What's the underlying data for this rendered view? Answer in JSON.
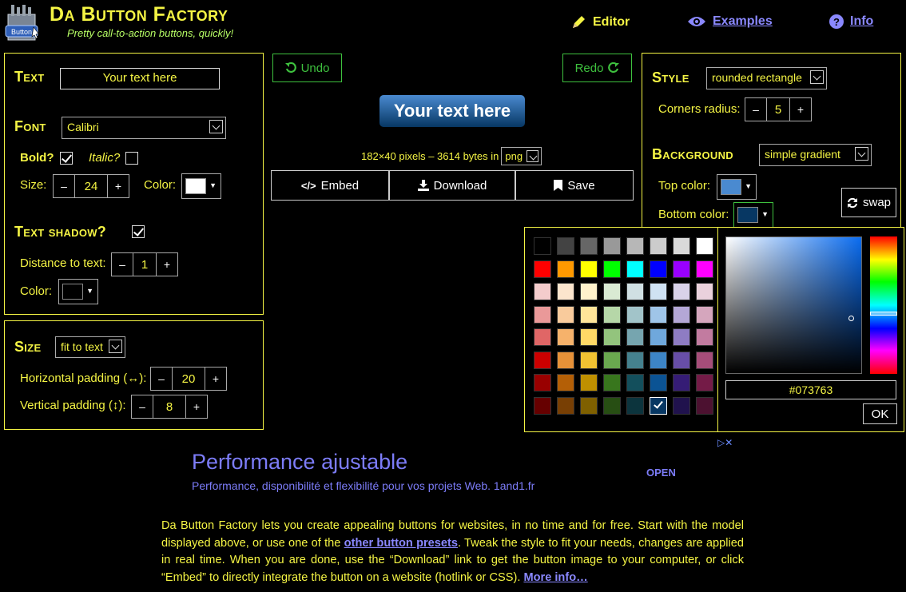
{
  "header": {
    "logo_text": "Button",
    "brand": "Da Button Factory",
    "tagline": "Pretty call-to-action buttons, quickly!",
    "nav": [
      {
        "label": "Editor",
        "icon": "pencil-icon"
      },
      {
        "label": "Examples",
        "icon": "eye-icon"
      },
      {
        "label": "Info",
        "icon": "question-icon"
      }
    ]
  },
  "text_panel": {
    "text_title": "Text",
    "text_value": "Your text here",
    "font_title": "Font",
    "font_value": "Calibri",
    "bold_label": "Bold?",
    "bold_checked": true,
    "italic_label": "Italic?",
    "italic_checked": false,
    "size_label": "Size:",
    "size_value": "24",
    "color_label": "Color:",
    "color_value": "#ffffff",
    "shadow_title": "Text shadow?",
    "shadow_checked": true,
    "distance_label": "Distance to text:",
    "distance_value": "1",
    "shadow_color_label": "Color:",
    "shadow_color_value": "#000000"
  },
  "size_panel": {
    "title": "Size",
    "mode": "fit to text",
    "hpad_label": "Horizontal padding (↔):",
    "hpad_value": "20",
    "vpad_label": "Vertical padding (↕):",
    "vpad_value": "8"
  },
  "center": {
    "undo": "Undo",
    "redo": "Redo",
    "preview_text": "Your text here",
    "info_text": "182×40 pixels – 3614 bytes in",
    "format": "png",
    "embed": "Embed",
    "download": "Download",
    "save": "Save"
  },
  "style_panel": {
    "style_title": "Style",
    "style_value": "rounded rectangle",
    "corners_label": "Corners radius:",
    "corners_value": "5",
    "bg_title": "Background",
    "bg_value": "simple gradient",
    "top_color_label": "Top color:",
    "top_color_value": "#4a8ad0",
    "bottom_color_label": "Bottom color:",
    "bottom_color_value": "#073763",
    "swap": "swap"
  },
  "picker": {
    "hex": "#073763",
    "ok": "OK",
    "palette": [
      [
        "#000000",
        "#434343",
        "#666666",
        "#999999",
        "#b7b7b7",
        "#cccccc",
        "#d9d9d9",
        "#ffffff"
      ],
      [
        "#ff0000",
        "#ff9900",
        "#ffff00",
        "#00ff00",
        "#00ffff",
        "#0000ff",
        "#9900ff",
        "#ff00ff"
      ],
      [
        "#f4cccc",
        "#fce5cd",
        "#fff2cc",
        "#d9ead3",
        "#d0e0e3",
        "#cfe2f3",
        "#d9d2e9",
        "#ead1dc"
      ],
      [
        "#ea9999",
        "#f9cb9c",
        "#ffe599",
        "#b6d7a8",
        "#a2c4c9",
        "#9fc5e8",
        "#b4a7d6",
        "#d5a6bd"
      ],
      [
        "#e06666",
        "#f6b26b",
        "#ffd966",
        "#93c47d",
        "#76a5af",
        "#6fa8dc",
        "#8e7cc3",
        "#c27ba0"
      ],
      [
        "#cc0000",
        "#e69138",
        "#f1c232",
        "#6aa84f",
        "#45818e",
        "#3d85c6",
        "#674ea7",
        "#a64d79"
      ],
      [
        "#990000",
        "#b45f06",
        "#bf9000",
        "#38761d",
        "#134f5c",
        "#0b5394",
        "#351c75",
        "#741b47"
      ],
      [
        "#660000",
        "#783f04",
        "#7f6000",
        "#274e13",
        "#0c343d",
        "#073763",
        "#20124d",
        "#4c1130"
      ]
    ],
    "selected_row": 7,
    "selected_col": 5
  },
  "ad": {
    "title": "Performance ajustable",
    "subtitle": "Performance, disponibilité et flexibilité pour vos projets Web. 1and1.fr",
    "open": "OPEN"
  },
  "description": {
    "part1": "Da Button Factory lets you create appealing buttons for websites, in no time and for free. Start with the model displayed above, or use one of the ",
    "link1": "other button presets",
    "part2": ". Tweak the style to fit your needs, changes are applied in real time. When you are done, use the “Download” link to get the button image to your computer, or click “Embed” to directly integrate the button on a website (hotlink or CSS). ",
    "link2": "More info…"
  }
}
